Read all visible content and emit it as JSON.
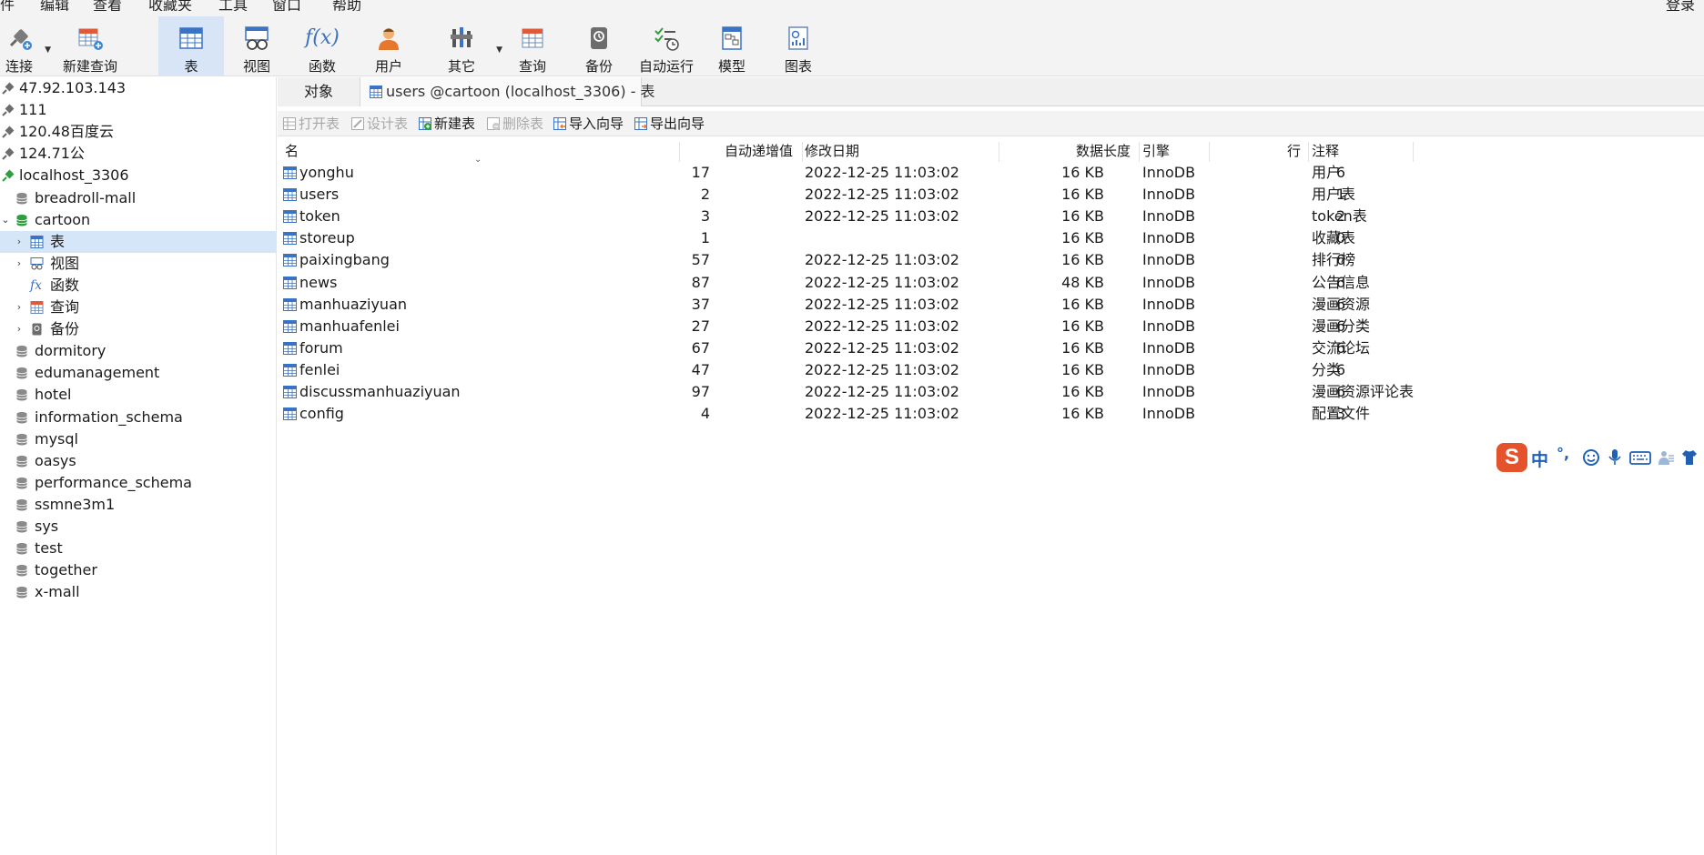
{
  "menubar": {
    "items": [
      "件",
      "编辑",
      "查看",
      "收藏夹",
      "工具",
      "窗口",
      "帮助"
    ],
    "login": "登录"
  },
  "toolbar": {
    "connect": "连接",
    "new_query": "新建查询",
    "table": "表",
    "view": "视图",
    "function": "函数",
    "user": "用户",
    "other": "其它",
    "query": "查询",
    "backup": "备份",
    "automation": "自动运行",
    "model": "模型",
    "chart": "图表",
    "function_glyph": "f(x)"
  },
  "sidebar": {
    "connections": [
      {
        "label": "47.92.103.143",
        "status": "inactive"
      },
      {
        "label": "111",
        "status": "inactive"
      },
      {
        "label": "120.48百度云",
        "status": "inactive"
      },
      {
        "label": "124.71公",
        "status": "inactive"
      },
      {
        "label": "localhost_3306",
        "status": "active"
      }
    ],
    "databases_before": [
      "breadroll-mall"
    ],
    "open_database": "cartoon",
    "open_children": [
      "表",
      "视图",
      "函数",
      "查询",
      "备份"
    ],
    "databases_after": [
      "dormitory",
      "edumanagement",
      "hotel",
      "information_schema",
      "mysql",
      "oasys",
      "performance_schema",
      "ssmne3m1",
      "sys",
      "test",
      "together",
      "x-mall"
    ]
  },
  "tabs": {
    "objects": "对象",
    "table_tab": "users @cartoon (localhost_3306) - 表"
  },
  "object_toolbar": {
    "open_table": "打开表",
    "design_table": "设计表",
    "new_table": "新建表",
    "delete_table": "删除表",
    "import_wizard": "导入向导",
    "export_wizard": "导出向导"
  },
  "grid": {
    "columns": {
      "name": "名",
      "auto_increment": "自动递增值",
      "modified": "修改日期",
      "data_length": "数据长度",
      "engine": "引擎",
      "rows": "行",
      "comment": "注释"
    },
    "tables": [
      {
        "name": "yonghu",
        "auto": "17",
        "modified": "2022-12-25 11:03:02",
        "size": "16 KB",
        "engine": "InnoDB",
        "rows": "6",
        "comment": "用户"
      },
      {
        "name": "users",
        "auto": "2",
        "modified": "2022-12-25 11:03:02",
        "size": "16 KB",
        "engine": "InnoDB",
        "rows": "1",
        "comment": "用户表"
      },
      {
        "name": "token",
        "auto": "3",
        "modified": "2022-12-25 11:03:02",
        "size": "16 KB",
        "engine": "InnoDB",
        "rows": "2",
        "comment": "token表"
      },
      {
        "name": "storeup",
        "auto": "1",
        "modified": "",
        "size": "16 KB",
        "engine": "InnoDB",
        "rows": "0",
        "comment": "收藏表"
      },
      {
        "name": "paixingbang",
        "auto": "57",
        "modified": "2022-12-25 11:03:02",
        "size": "16 KB",
        "engine": "InnoDB",
        "rows": "6",
        "comment": "排行榜"
      },
      {
        "name": "news",
        "auto": "87",
        "modified": "2022-12-25 11:03:02",
        "size": "48 KB",
        "engine": "InnoDB",
        "rows": "6",
        "comment": "公告信息"
      },
      {
        "name": "manhuaziyuan",
        "auto": "37",
        "modified": "2022-12-25 11:03:02",
        "size": "16 KB",
        "engine": "InnoDB",
        "rows": "6",
        "comment": "漫画资源"
      },
      {
        "name": "manhuafenlei",
        "auto": "27",
        "modified": "2022-12-25 11:03:02",
        "size": "16 KB",
        "engine": "InnoDB",
        "rows": "6",
        "comment": "漫画分类"
      },
      {
        "name": "forum",
        "auto": "67",
        "modified": "2022-12-25 11:03:02",
        "size": "16 KB",
        "engine": "InnoDB",
        "rows": "6",
        "comment": "交流论坛"
      },
      {
        "name": "fenlei",
        "auto": "47",
        "modified": "2022-12-25 11:03:02",
        "size": "16 KB",
        "engine": "InnoDB",
        "rows": "6",
        "comment": "分类"
      },
      {
        "name": "discussmanhuaziyuan",
        "auto": "97",
        "modified": "2022-12-25 11:03:02",
        "size": "16 KB",
        "engine": "InnoDB",
        "rows": "6",
        "comment": "漫画资源评论表"
      },
      {
        "name": "config",
        "auto": "4",
        "modified": "2022-12-25 11:03:02",
        "size": "16 KB",
        "engine": "InnoDB",
        "rows": "3",
        "comment": "配置文件"
      }
    ]
  },
  "ime": {
    "logo": "S",
    "mode": "中",
    "punct": "°,"
  },
  "colors": {
    "accent": "#2f7bd6",
    "selected_bg": "#d5e6f8",
    "db_icon": "#8a8a8a",
    "db_active": "#2e9e3f"
  }
}
